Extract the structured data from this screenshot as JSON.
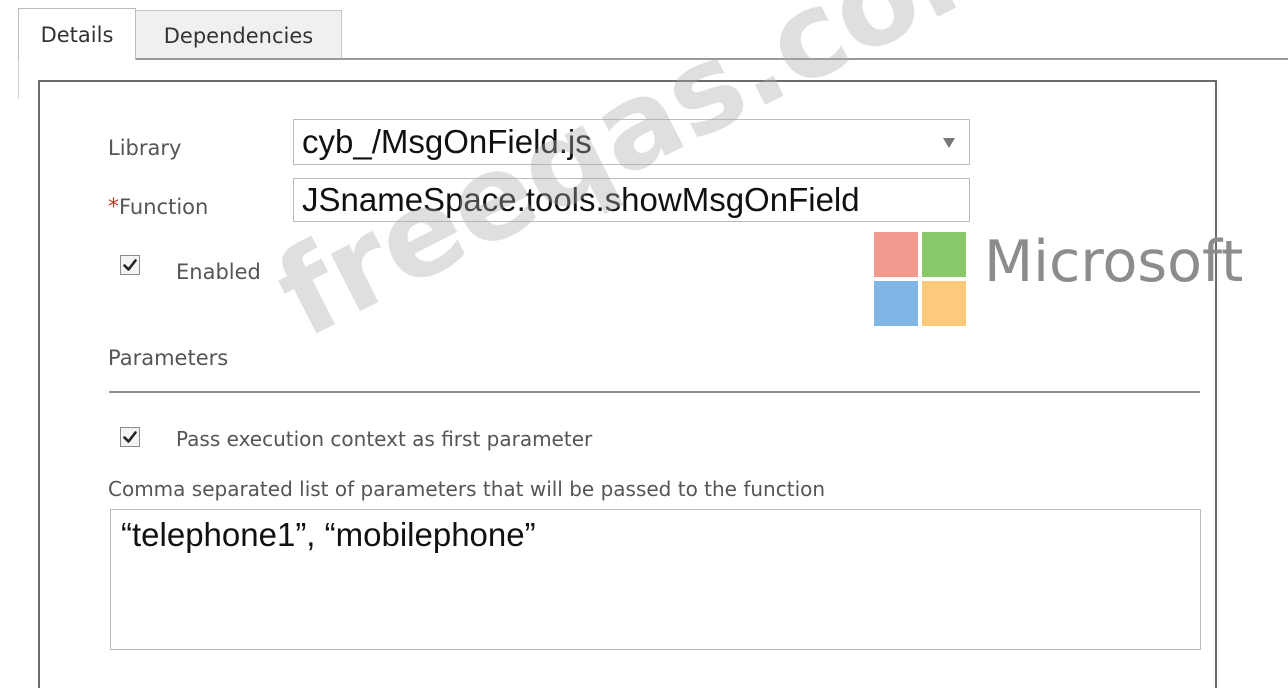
{
  "tabs": [
    {
      "label": "Details",
      "active": true
    },
    {
      "label": "Dependencies",
      "active": false
    }
  ],
  "form": {
    "library_label": "Library",
    "library_value": "cyb_/MsgOnField.js",
    "function_required_mark": "*",
    "function_label": "Function",
    "function_value": "JSnameSpace.tools.showMsgOnField",
    "enabled_label": "Enabled",
    "enabled_checked": true,
    "parameters_heading": "Parameters",
    "pass_context_label": "Pass execution context as first parameter",
    "pass_context_checked": true,
    "params_list_label": "Comma separated list of parameters that will be passed to the function",
    "params_list_value": "“telephone1”, “mobilephone”"
  },
  "logo": {
    "text": "Microsoft",
    "colors": [
      "#f1998e",
      "#88c96a",
      "#7fb6e6",
      "#fcca7a"
    ]
  },
  "watermark": {
    "text": "freeqas.com"
  },
  "colors": {
    "required": "#c0392b",
    "panel_border": "#6b6b6b",
    "divider": "#8e8e8e"
  }
}
